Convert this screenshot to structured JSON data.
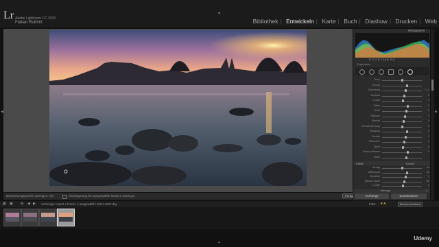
{
  "identity": {
    "logo": "Lr",
    "line1": "Adobe Lightroom CC 2015",
    "line2": "Fabian Rußhirt"
  },
  "modules": [
    "Bibliothek",
    "Entwickeln",
    "Karte",
    "Buch",
    "Diashow",
    "Drucken",
    "Web"
  ],
  "active_module": "Entwickeln",
  "toolbar": {
    "left_text": "Bearbeitungsansicht anzeigen: Nie",
    "note": "Überlagerung für ausgewählte Masken anzeigen",
    "done_button": "Fertig"
  },
  "right_panel": {
    "histogram_label": "Histogramm",
    "histogram_values": "R  72,2  G  73,6  B  79,3",
    "original_label": "Originalfoto",
    "basic_sliders": [
      {
        "label": "Temp",
        "value": ""
      },
      {
        "label": "Tönung",
        "value": ""
      },
      {
        "label": "Belichtung",
        "value": "+1,0"
      },
      {
        "label": "Kontrast",
        "value": "0"
      },
      {
        "label": "Lichter",
        "value": "0"
      },
      {
        "label": "Tiefen",
        "value": "0"
      },
      {
        "label": "Weiß",
        "value": "0"
      },
      {
        "label": "Schwarz",
        "value": "0"
      },
      {
        "label": "Klarheit",
        "value": "0"
      },
      {
        "label": "Dunstentfernung",
        "value": "0"
      },
      {
        "label": "Sättigung",
        "value": "0"
      },
      {
        "label": "Schärfe",
        "value": "0"
      },
      {
        "label": "Rauschen",
        "value": "0"
      },
      {
        "label": "Moiré",
        "value": "0"
      },
      {
        "label": "Rand entfernen",
        "value": "0"
      },
      {
        "label": "Farbe",
        "value": ""
      }
    ],
    "effect_header": "Effekt",
    "effect_mode": "Lichter",
    "vignette_sliders": [
      {
        "label": "Betrag",
        "value": "-10"
      },
      {
        "label": "Mittelpunkt",
        "value": "50"
      },
      {
        "label": "Rundheit",
        "value": "0"
      },
      {
        "label": "Weiche Kante",
        "value": "50"
      },
      {
        "label": "Lichter",
        "value": "0"
      }
    ],
    "grain_header": "Körnung",
    "grain_value": "0",
    "prev_button": "Vorherige",
    "reset_button": "Zurücksetzen"
  },
  "filmstrip": {
    "path": "Vorheriger Import   4 Fotos / 1 ausgewählt / IMG1-HDR.dng",
    "filter_label": "Filter:",
    "filter_value": "Benutzerdefiniert"
  },
  "watermark": "Udemy"
}
